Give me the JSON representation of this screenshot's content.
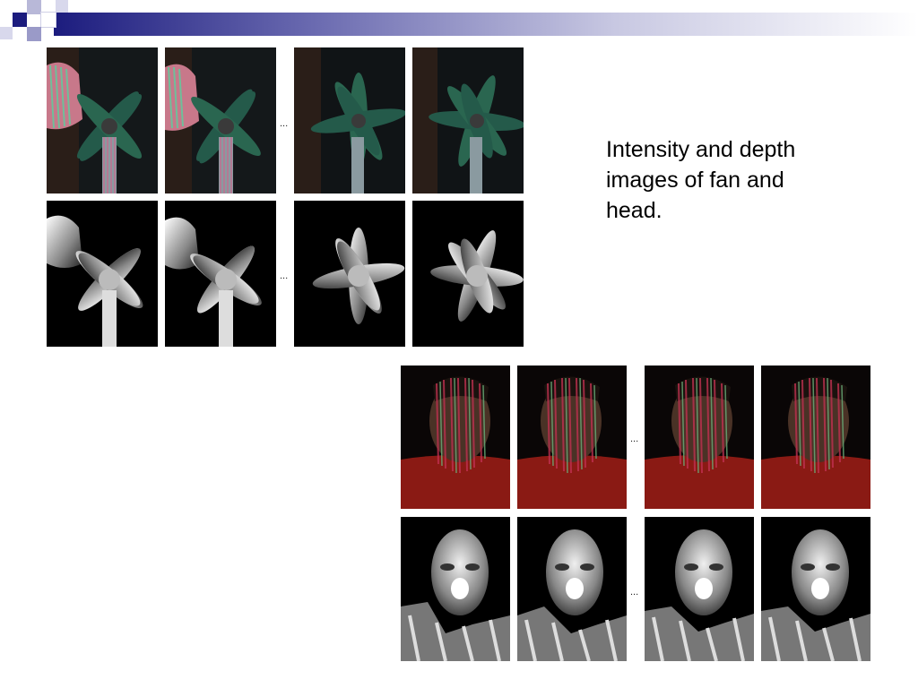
{
  "slide": {
    "caption": "Intensity and depth images of fan and head.",
    "ellipsis": "..."
  },
  "figures": {
    "fan": {
      "intensity_frames": 4,
      "depth_frames": 4
    },
    "head": {
      "intensity_frames": 4,
      "depth_frames": 4
    }
  }
}
